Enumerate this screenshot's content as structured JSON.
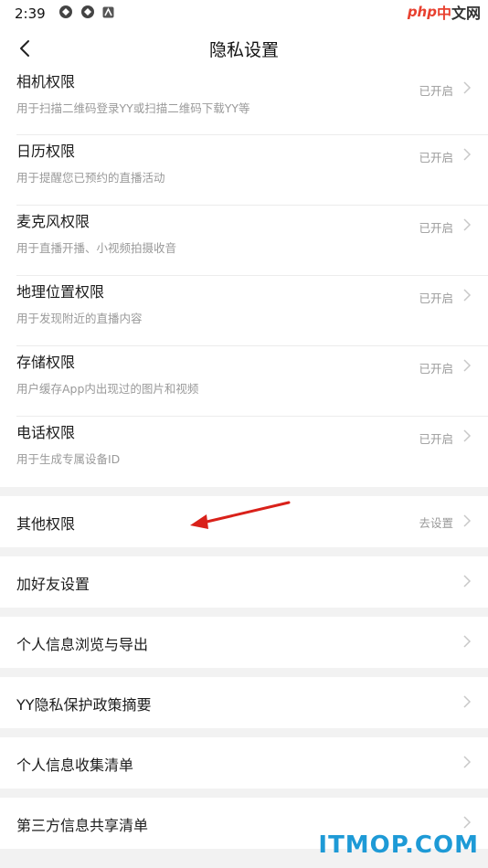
{
  "status_bar": {
    "time": "2:39",
    "icons": [
      "app-notification-icon",
      "app-notification-icon",
      "android-system-icon"
    ]
  },
  "watermark_top": {
    "php": "php",
    "cn1": "中",
    "cn2": "文网"
  },
  "header": {
    "back_icon": "chevron-left-icon",
    "title": "隐私设置"
  },
  "permissions": [
    {
      "title": "相机权限",
      "desc": "用于扫描二维码登录YY或扫描二维码下载YY等",
      "status": "已开启"
    },
    {
      "title": "日历权限",
      "desc": "用于提醒您已预约的直播活动",
      "status": "已开启"
    },
    {
      "title": "麦克风权限",
      "desc": "用于直播开播、小视频拍摄收音",
      "status": "已开启"
    },
    {
      "title": "地理位置权限",
      "desc": "用于发现附近的直播内容",
      "status": "已开启"
    },
    {
      "title": "存储权限",
      "desc": "用户缓存App内出现过的图片和视频",
      "status": "已开启"
    },
    {
      "title": "电话权限",
      "desc": "用于生成专属设备ID",
      "status": "已开启"
    }
  ],
  "other_permissions": {
    "label": "其他权限",
    "status": "去设置"
  },
  "menu_items": [
    {
      "label": "加好友设置"
    },
    {
      "label": "个人信息浏览与导出"
    },
    {
      "label": "YY隐私保护政策摘要"
    },
    {
      "label": "个人信息收集清单"
    },
    {
      "label": "第三方信息共享清单"
    }
  ],
  "watermark_bottom": "ITMOP.COM",
  "colors": {
    "arrow": "#d9211a",
    "divider": "#f2f2f2",
    "muted_text": "#9a9a9a",
    "watermark": "#1e9ad6"
  }
}
